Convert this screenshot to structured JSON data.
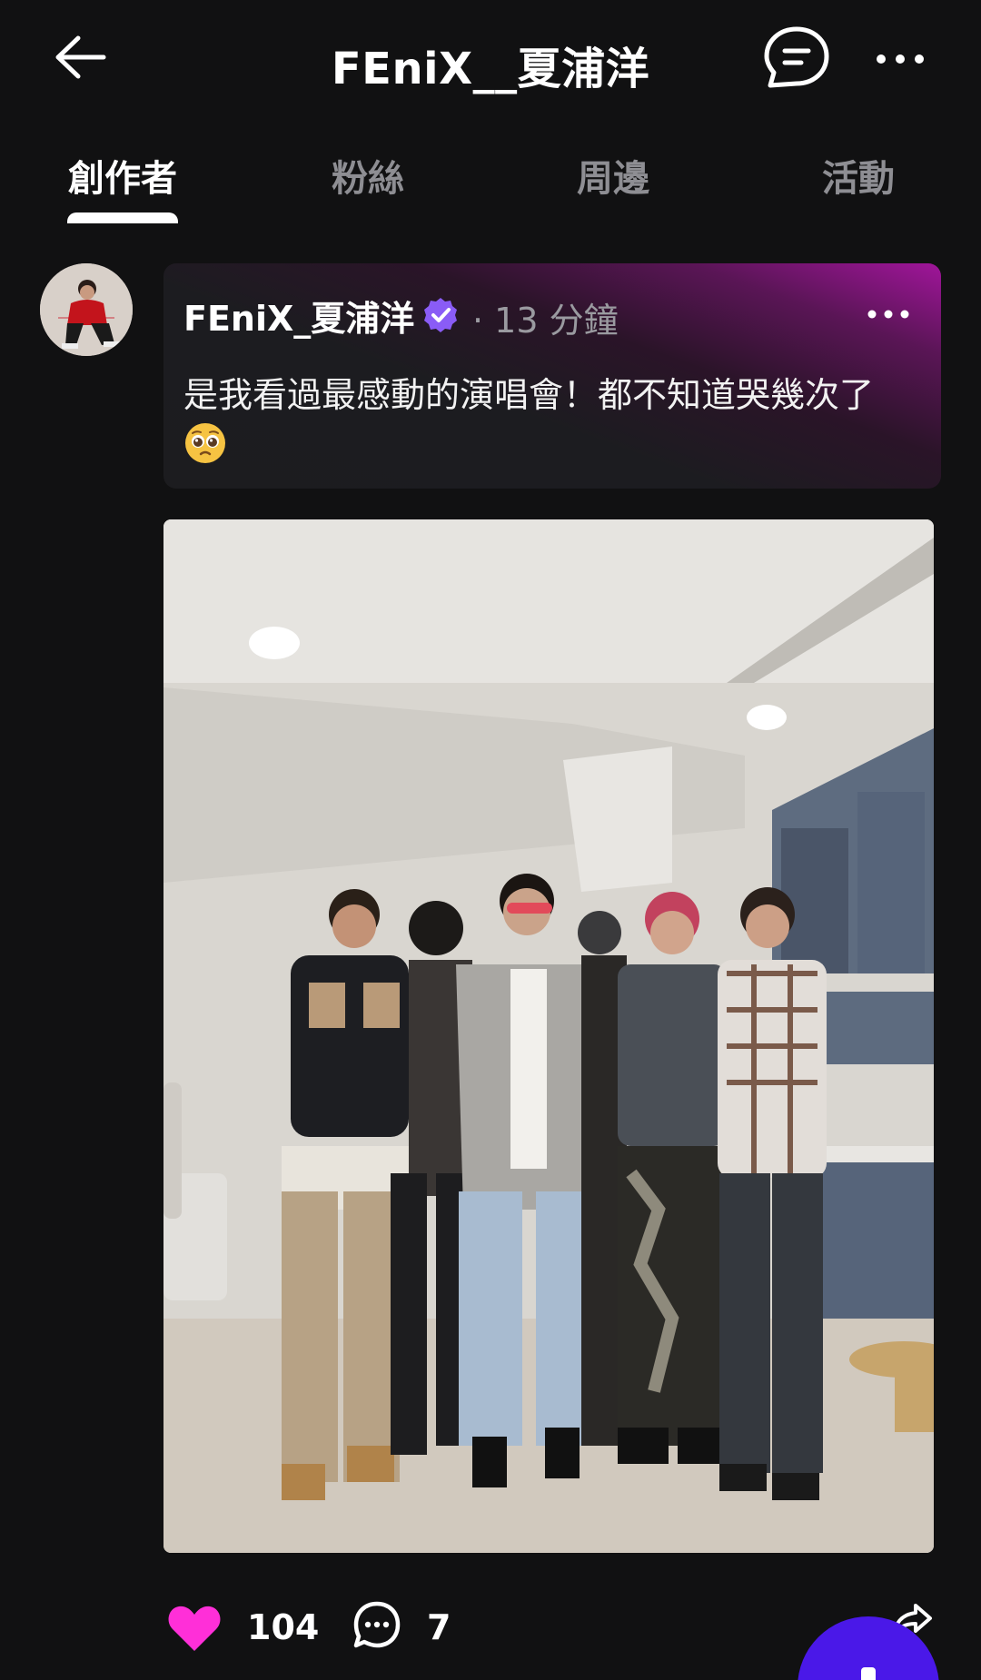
{
  "header": {
    "title": "FEniX__夏浦洋",
    "back_icon": "arrow-left-icon",
    "chat_icon": "chat-bubble-icon",
    "more_icon": "more-horizontal-icon"
  },
  "tabs": [
    {
      "label": "創作者",
      "active": true
    },
    {
      "label": "粉絲",
      "active": false
    },
    {
      "label": "周邊",
      "active": false
    },
    {
      "label": "活動",
      "active": false
    }
  ],
  "post": {
    "author": "FEniX_夏浦洋",
    "verified": true,
    "time": "· 13 分鐘",
    "text": "是我看過最感動的演唱會！都不知道哭幾次了",
    "emoji": "pleading-face",
    "likes": "104",
    "comments": "7"
  },
  "colors": {
    "background": "#111112",
    "accent_pink": "#ff2fd8",
    "verified_purple": "#8a5cf6",
    "fab_blue": "#4a18e8"
  }
}
